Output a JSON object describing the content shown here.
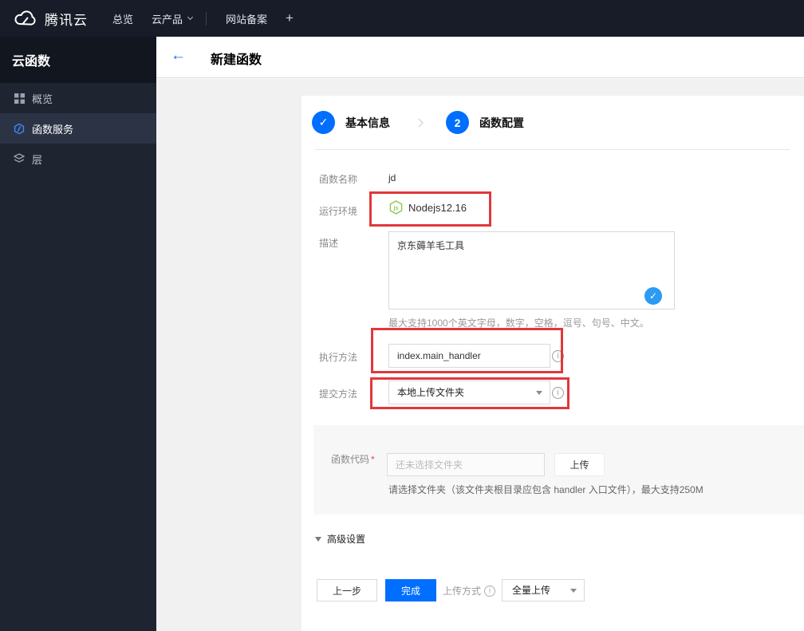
{
  "topbar": {
    "brand": "腾讯云",
    "nav": [
      {
        "label": "总览"
      },
      {
        "label": "云产品"
      },
      {
        "label": "网站备案"
      },
      {
        "label": "+"
      }
    ]
  },
  "sidebar": {
    "title": "云函数",
    "items": [
      {
        "label": "概览",
        "icon": "grid-icon",
        "active": false
      },
      {
        "label": "函数服务",
        "icon": "function-hexagon-icon",
        "active": true
      },
      {
        "label": "层",
        "icon": "layers-icon",
        "active": false
      }
    ]
  },
  "header": {
    "back_glyph": "←",
    "title": "新建函数"
  },
  "steps": {
    "step1": {
      "label": "基本信息",
      "status": "completed",
      "check_glyph": "✓"
    },
    "step2": {
      "label": "函数配置",
      "number": "2",
      "status": "current"
    }
  },
  "form": {
    "name": {
      "label": "函数名称",
      "value": "jd"
    },
    "runtime": {
      "label": "运行环境",
      "value": "Nodejs12.16",
      "icon": "nodejs-icon"
    },
    "description": {
      "label": "描述",
      "value": "京东薅羊毛工具",
      "valid_glyph": "✓",
      "hint": "最大支持1000个英文字母，数字，空格，逗号、句号、中文。"
    },
    "handler": {
      "label": "执行方法",
      "value": "index.main_handler",
      "info_glyph": "i"
    },
    "submit_method": {
      "label": "提交方法",
      "value": "本地上传文件夹",
      "info_glyph": "i"
    },
    "code": {
      "label": "函数代码",
      "required_mark": "*",
      "placeholder": "还未选择文件夹",
      "upload_button": "上传",
      "hint": "请选择文件夹（该文件夹根目录应包含 handler 入口文件），最大支持250M"
    },
    "advanced": {
      "label": "高级设置"
    }
  },
  "footer": {
    "prev_button": "上一步",
    "finish_button": "完成",
    "upload_mode_label": "上传方式",
    "upload_mode_info_glyph": "i",
    "upload_mode_value": "全量上传"
  },
  "colors": {
    "accent_blue": "#006eff",
    "annotation_red": "#e0383c",
    "nodejs_green": "#8cc84b",
    "valid_check_blue": "#2b9bf3",
    "topbar_bg": "#171c28",
    "sidebar_bg": "#1e2430"
  }
}
